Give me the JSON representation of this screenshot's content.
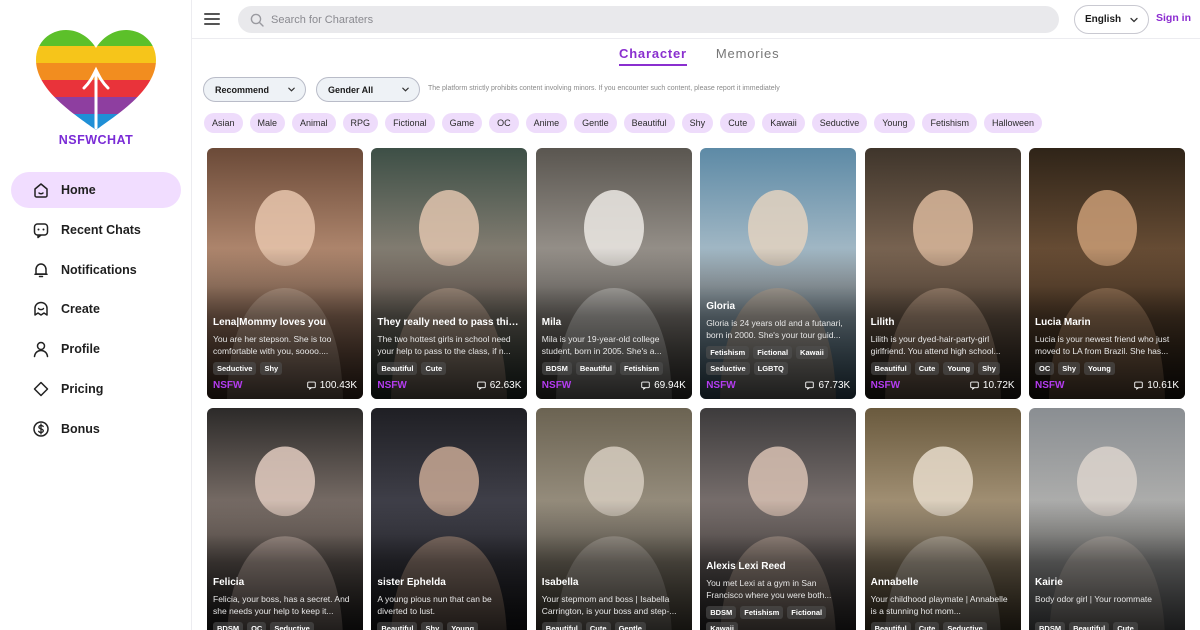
{
  "brand": {
    "logo_text": "NSFWCHAT"
  },
  "sidebar": {
    "items": [
      {
        "label": "Home",
        "icon": "home-icon",
        "active": true
      },
      {
        "label": "Recent Chats",
        "icon": "chat-icon",
        "active": false
      },
      {
        "label": "Notifications",
        "icon": "bell-icon",
        "active": false
      },
      {
        "label": "Create",
        "icon": "create-icon",
        "active": false
      },
      {
        "label": "Profile",
        "icon": "user-icon",
        "active": false
      },
      {
        "label": "Pricing",
        "icon": "diamond-icon",
        "active": false
      },
      {
        "label": "Bonus",
        "icon": "dollar-icon",
        "active": false
      }
    ]
  },
  "header": {
    "search_placeholder": "Search for Charaters",
    "language": "English",
    "signin": "Sign in"
  },
  "tabs": [
    {
      "label": "Character",
      "active": true
    },
    {
      "label": "Memories",
      "active": false
    }
  ],
  "filters": {
    "sort": "Recommend",
    "gender": "Gender All",
    "notice": "The platform strictly prohibits content involving minors. If you encounter such content, please report it immediately"
  },
  "tags": [
    "Asian",
    "Male",
    "Animal",
    "RPG",
    "Fictional",
    "Game",
    "OC",
    "Anime",
    "Gentle",
    "Beautiful",
    "Shy",
    "Cute",
    "Kawaii",
    "Seductive",
    "Young",
    "Fetishism",
    "Halloween"
  ],
  "colors": {
    "accent": "#8a2fcf",
    "nsfw": "#b43cf0",
    "active_nav": "#f1ddff",
    "tag_bg": "#eedcfb"
  },
  "cards": [
    {
      "name": "Lena|Mommy loves you",
      "desc": "You are her stepson. She is too comfortable with you, soooo....",
      "tags": [
        "Seductive",
        "Shy"
      ],
      "badge": "NSFW",
      "count": "100.43K"
    },
    {
      "name": "They really need to pass this...",
      "desc": "The two hottest girls in school need your help to pass to the class, if n...",
      "tags": [
        "Beautiful",
        "Cute"
      ],
      "badge": "NSFW",
      "count": "62.63K"
    },
    {
      "name": "Mila",
      "desc": "Mila is your 19-year-old college student, born in 2005. She's a...",
      "tags": [
        "BDSM",
        "Beautiful",
        "Fetishism"
      ],
      "badge": "NSFW",
      "count": "69.94K"
    },
    {
      "name": "Gloria",
      "desc": "Gloria is 24 years old and a futanari, born in 2000. She's your tour guid...",
      "tags": [
        "Fetishism",
        "Fictional",
        "Kawaii",
        "Seductive",
        "LGBTQ"
      ],
      "badge": "NSFW",
      "count": "67.73K"
    },
    {
      "name": "Lilith",
      "desc": "Lilith is your dyed-hair-party-girl girlfriend. You attend high school...",
      "tags": [
        "Beautiful",
        "Cute",
        "Young",
        "Shy"
      ],
      "badge": "NSFW",
      "count": "10.72K"
    },
    {
      "name": "Lucia Marin",
      "desc": "Lucia is your newest friend who just moved to LA from Brazil. She has...",
      "tags": [
        "OC",
        "Shy",
        "Young"
      ],
      "badge": "NSFW",
      "count": "10.61K"
    },
    {
      "name": "Felicia",
      "desc": "Felicia, your boss, has a secret. And she needs your help to keep it...",
      "tags": [
        "BDSM",
        "OC",
        "Seductive"
      ],
      "badge": "",
      "count": ""
    },
    {
      "name": "sister Ephelda",
      "desc": "A young pious nun that can be diverted to lust.",
      "tags": [
        "Beautiful",
        "Shy",
        "Young"
      ],
      "badge": "",
      "count": ""
    },
    {
      "name": "Isabella",
      "desc": "Your stepmom and boss | Isabella Carrington, is your boss and step-...",
      "tags": [
        "Beautiful",
        "Cute",
        "Gentle"
      ],
      "badge": "",
      "count": ""
    },
    {
      "name": "Alexis Lexi Reed",
      "desc": "You met Lexi at a gym in San Francisco where you were both...",
      "tags": [
        "BDSM",
        "Fetishism",
        "Fictional",
        "Kawaii"
      ],
      "badge": "",
      "count": ""
    },
    {
      "name": "Annabelle",
      "desc": "Your childhood playmate | Annabelle is a stunning hot mom...",
      "tags": [
        "Beautiful",
        "Cute",
        "Seductive"
      ],
      "badge": "",
      "count": ""
    },
    {
      "name": "Kairie",
      "desc": "Body odor girl | Your roommate",
      "tags": [
        "BDSM",
        "Beautiful",
        "Cute"
      ],
      "badge": "",
      "count": ""
    }
  ]
}
